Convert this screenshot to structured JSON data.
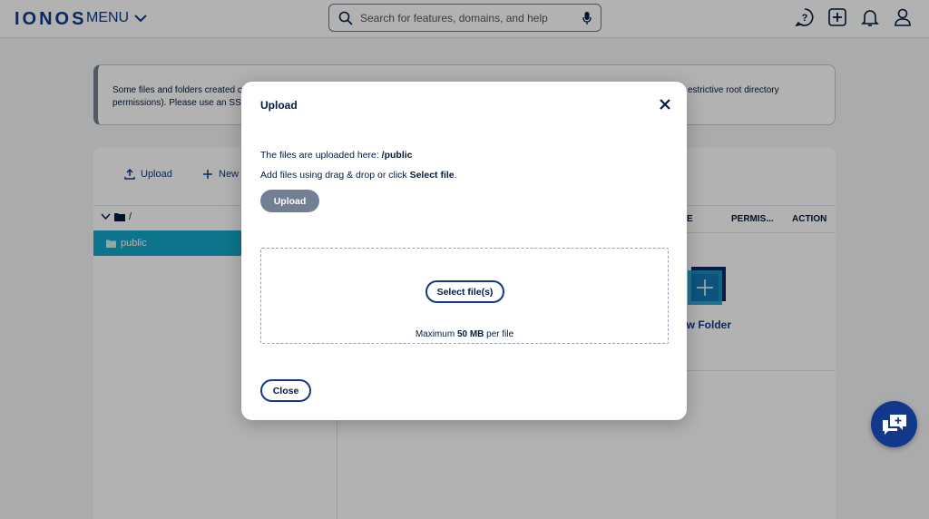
{
  "header": {
    "logo": "IONOS",
    "menu_label": "MENU",
    "search_placeholder": "Search for features, domains, and help",
    "icons": [
      "help-icon",
      "add-icon",
      "bell-icon",
      "user-icon"
    ]
  },
  "banner": {
    "text_left": "Some files and folders created c permissions). Please use an SSH",
    "text_right": "estrictive root directory"
  },
  "toolbar": {
    "upload_label": "Upload",
    "new_label": "New"
  },
  "tree": {
    "root_label": "/",
    "public_label": "public"
  },
  "table": {
    "columns": [
      "E",
      "PERMIS...",
      "ACTION"
    ]
  },
  "content": {
    "new_folder_label": "ew Folder"
  },
  "modal": {
    "title": "Upload",
    "upload_path_prefix": "The files are uploaded here: ",
    "upload_path": "/public",
    "instruction_prefix": "Add files using drag & drop or click ",
    "instruction_bold": "Select file",
    "instruction_suffix": ".",
    "upload_button": "Upload",
    "select_button": "Select file(s)",
    "max_prefix": "Maximum ",
    "max_size": "50 MB",
    "max_suffix": " per file",
    "close_button": "Close"
  },
  "colors": {
    "brand": "#11388a",
    "accent_cyan": "#14a8c8",
    "disabled_button": "#718095"
  }
}
